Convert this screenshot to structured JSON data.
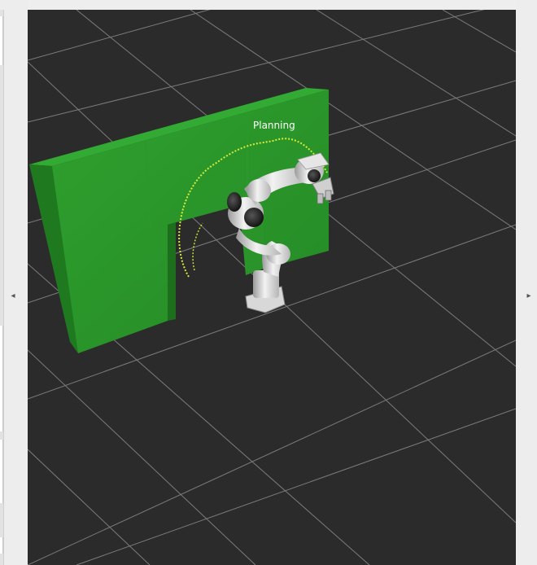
{
  "viewport": {
    "status_text": "Planning",
    "background_color": "#2b2b2b",
    "grid_color": "#8a8a8a",
    "obstacle_color": "#2e9f2e",
    "trajectory_color": "#d8ea3a"
  },
  "left_collapse": {
    "icon": "arrow-left-icon",
    "glyph": "◂"
  },
  "right_collapse": {
    "icon": "arrow-right-icon",
    "glyph": "▸"
  }
}
